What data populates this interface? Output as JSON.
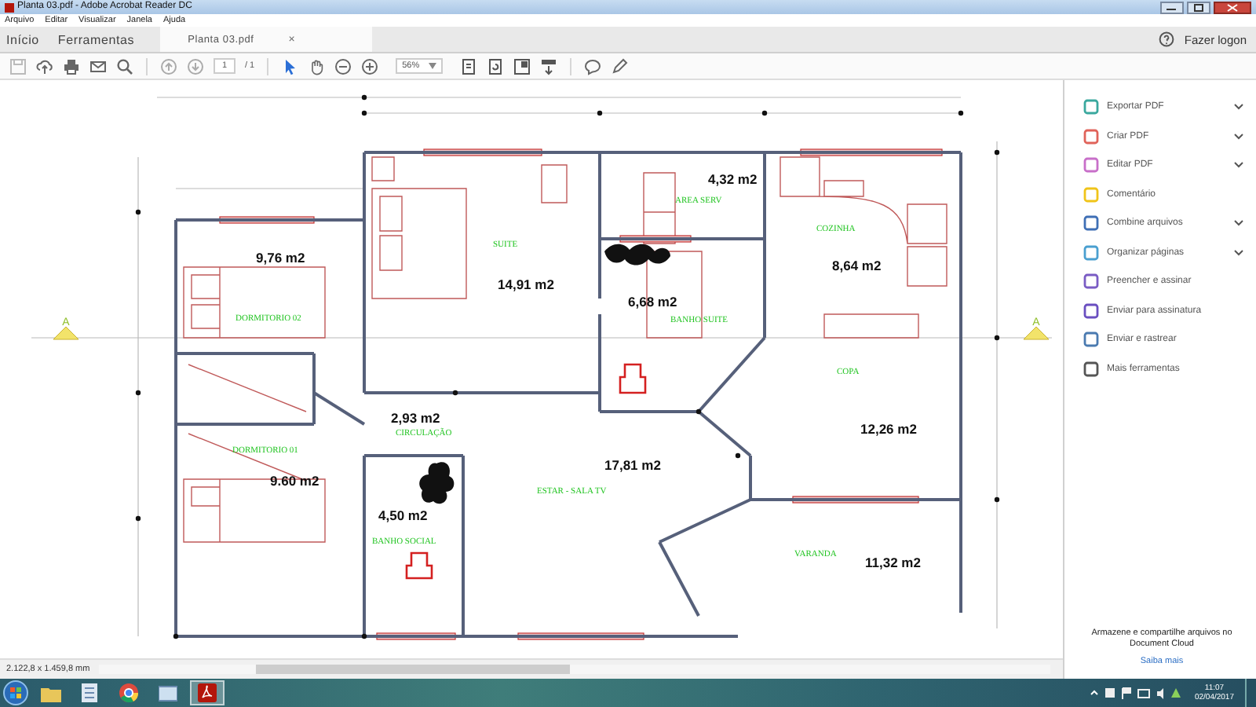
{
  "window": {
    "title": "Planta 03.pdf - Adobe Acrobat Reader DC"
  },
  "menu": [
    "Arquivo",
    "Editar",
    "Visualizar",
    "Janela",
    "Ajuda"
  ],
  "tabs": [
    {
      "label": "Início",
      "selected": false
    },
    {
      "label": "Ferramentas",
      "selected": false
    },
    {
      "label": "Planta 03.pdf",
      "selected": true,
      "close": "×"
    }
  ],
  "account": {
    "label": "Fazer logon"
  },
  "toolbar": {
    "page": "1",
    "page_total": "/ 1",
    "zoom": "56%"
  },
  "plan": {
    "section_marks": [
      "A",
      "A"
    ],
    "rooms": [
      {
        "name": "DORMITORIO 02",
        "area": "9,76 m2"
      },
      {
        "name": "SUITE",
        "area": "14,91 m2"
      },
      {
        "name": "AREA SERV",
        "area": "4,32 m2"
      },
      {
        "name": "COZINHA",
        "area": "8,64 m2"
      },
      {
        "name": "BANHO SUITE",
        "area": "6,68 m2"
      },
      {
        "name": "CIRCULAÇÃO",
        "area": "2,93 m2"
      },
      {
        "name": "COPA",
        "area": "12,26 m2"
      },
      {
        "name": "DORMITORIO 01",
        "area": "9.60 m2"
      },
      {
        "name": "ESTAR - SALA TV",
        "area": "17,81 m2"
      },
      {
        "name": "BANHO SOCIAL",
        "area": "4,50 m2"
      },
      {
        "name": "VARANDA",
        "area": "11,32 m2"
      }
    ]
  },
  "status_bar": {
    "size": "2.122,8 x 1.459,8 mm"
  },
  "tools_panel": {
    "items": [
      {
        "label": "Exportar PDF",
        "has_menu": true,
        "color": "#3aa89e"
      },
      {
        "label": "Criar PDF",
        "has_menu": true,
        "color": "#e0635a"
      },
      {
        "label": "Editar PDF",
        "has_menu": true,
        "color": "#c86fc9"
      },
      {
        "label": "Comentário",
        "has_menu": false,
        "color": "#f0c419"
      },
      {
        "label": "Combine arquivos",
        "has_menu": true,
        "color": "#3f6fb5"
      },
      {
        "label": "Organizar páginas",
        "has_menu": true,
        "color": "#4a9fd0"
      },
      {
        "label": "Preencher e assinar",
        "has_menu": false,
        "color": "#7a5cc4"
      },
      {
        "label": "Enviar para assinatura",
        "has_menu": false,
        "color": "#6a4fc0"
      },
      {
        "label": "Enviar e rastrear",
        "has_menu": false,
        "color": "#4a7ab0"
      },
      {
        "label": "Mais ferramentas",
        "has_menu": false,
        "color": "#555555"
      }
    ],
    "promo": "Armazene e compartilhe arquivos no Document Cloud",
    "link": "Saiba mais"
  },
  "taskbar": {
    "apps": [
      {
        "selected": false
      },
      {
        "selected": false
      },
      {
        "selected": false
      },
      {
        "selected": false
      },
      {
        "selected": true
      }
    ],
    "time": "11:07",
    "date": "02/04/2017"
  }
}
